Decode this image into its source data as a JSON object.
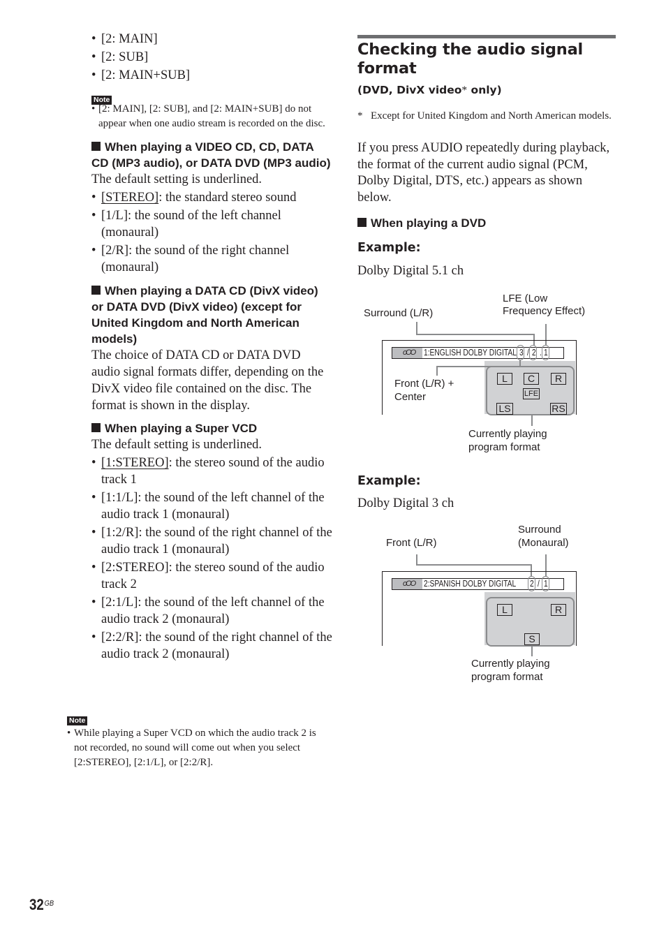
{
  "left_column": {
    "top_bullets": [
      "[2: MAIN]",
      "[2: SUB]",
      "[2: MAIN+SUB]"
    ],
    "note1": {
      "badge": "Note",
      "text": "[2: MAIN], [2: SUB], and [2: MAIN+SUB] do not appear when one audio stream is recorded on the disc."
    },
    "section_vcd": {
      "heading": "When playing a VIDEO CD, CD, DATA CD (MP3 audio), or DATA DVD (MP3 audio)",
      "intro": "The default setting is underlined.",
      "items": [
        {
          "option": "[STEREO]",
          "underlined": true,
          "desc": ": the standard stereo sound"
        },
        {
          "option": "[1/L]",
          "underlined": false,
          "desc": ": the sound of the left channel (monaural)"
        },
        {
          "option": "[2/R]",
          "underlined": false,
          "desc": ": the sound of the right channel (monaural)"
        }
      ]
    },
    "section_divx": {
      "heading": "When playing a DATA CD (DivX video) or DATA DVD (DivX video) (except for United Kingdom and North American models)",
      "body": "The choice of DATA CD or DATA DVD audio signal formats differ, depending on the DivX video file contained on the disc. The format is shown in the display."
    },
    "section_svcd": {
      "heading": "When playing a Super VCD",
      "intro": "The default setting is underlined.",
      "items": [
        {
          "option": "[1:STEREO]",
          "underlined": true,
          "desc": ": the stereo sound of the audio track 1"
        },
        {
          "option": "[1:1/L]",
          "underlined": false,
          "desc": ": the sound of the left channel of the audio track 1 (monaural)"
        },
        {
          "option": "[1:2/R]",
          "underlined": false,
          "desc": ": the sound of the right channel of the audio track 1 (monaural)"
        },
        {
          "option": "[2:STEREO]",
          "underlined": false,
          "desc": ": the stereo sound of the audio track 2"
        },
        {
          "option": "[2:1/L]",
          "underlined": false,
          "desc": ": the sound of the left channel of the audio track 2 (monaural)"
        },
        {
          "option": "[2:2/R]",
          "underlined": false,
          "desc": ": the sound of the right channel of the audio track 2 (monaural)"
        }
      ]
    },
    "note2": {
      "badge": "Note",
      "text": "While playing a Super VCD on which the audio track 2 is not recorded, no sound will come out when you select [2:STEREO], [2:1/L], or [2:2/R]."
    }
  },
  "right_column": {
    "title": "Checking the audio signal format",
    "subtitle_main": "(DVD, DivX video",
    "subtitle_asterisk": "*",
    "subtitle_end": " only)",
    "footnote_mark": "*",
    "footnote": "Except for United Kingdom and North American models.",
    "paragraph": "If you press AUDIO repeatedly during playback, the format of the current audio signal (PCM, Dolby Digital, DTS, etc.) appears as shown below.",
    "dvd_heading": "When playing a DVD",
    "example1": {
      "label": "Example:",
      "format": "Dolby Digital 5.1 ch",
      "disc_icon": "oOO",
      "display_prefix": "1:ENGLISH DOLBY DIGITAL",
      "digit_front": "3",
      "sep1": "/",
      "digit_surround": "2",
      "sep2": ".",
      "digit_lfe": "1",
      "callouts": {
        "surround": "Surround (L/R)",
        "lfe_line1": "LFE (Low",
        "lfe_line2": "Frequency Effect)",
        "front_line1": "Front (L/R) +",
        "front_line2": "Center",
        "program_line1": "Currently playing",
        "program_line2": "program format"
      },
      "channels": [
        "L",
        "C",
        "R",
        "LFE",
        "LS",
        "RS"
      ]
    },
    "example2": {
      "label": "Example:",
      "format": "Dolby Digital 3 ch",
      "disc_icon": "oOO",
      "display_prefix": "2:SPANISH DOLBY DIGITAL",
      "digit_front": "2",
      "sep1": "/",
      "digit_surround": "1",
      "callouts": {
        "front": "Front (L/R)",
        "surround_line1": "Surround",
        "surround_line2": "(Monaural)",
        "program_line1": "Currently playing",
        "program_line2": "program format"
      },
      "channels": [
        "L",
        "R",
        "S"
      ]
    }
  },
  "page_number": "32",
  "page_suffix": "GB"
}
